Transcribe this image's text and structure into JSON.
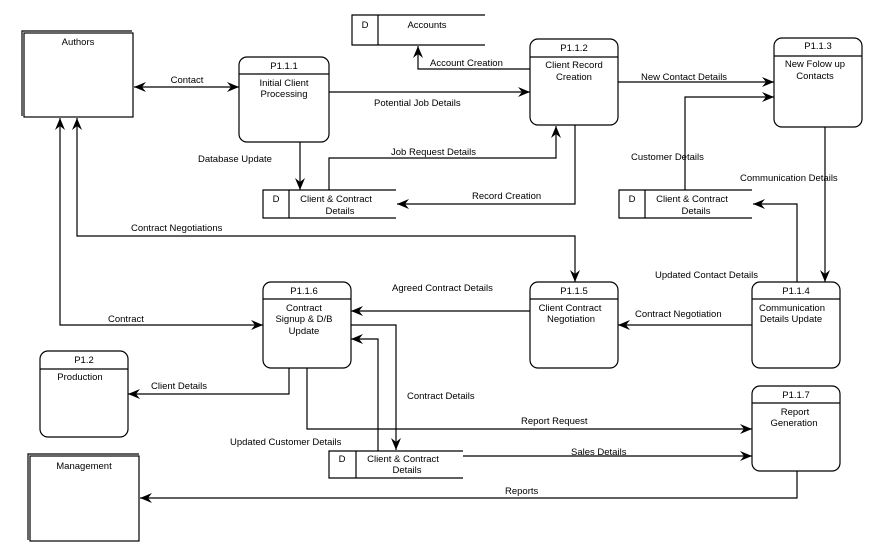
{
  "entities": {
    "authors": "Authors",
    "management": "Management"
  },
  "processes": {
    "p111": {
      "id": "P1.1.1",
      "lines": [
        "Initial Client",
        "Processing"
      ]
    },
    "p112": {
      "id": "P1.1.2",
      "lines": [
        "Client Record",
        "Creation"
      ]
    },
    "p113": {
      "id": "P1.1.3",
      "lines": [
        "New Folow up",
        "Contacts"
      ]
    },
    "p114": {
      "id": "P1.1.4",
      "lines": [
        "Communication",
        "Details Update"
      ]
    },
    "p115": {
      "id": "P1.1.5",
      "lines": [
        "Client Contract",
        "Negotiation"
      ]
    },
    "p116": {
      "id": "P1.1.6",
      "lines": [
        "Contract",
        "Signup & D/B",
        "Update"
      ]
    },
    "p117": {
      "id": "P1.1.7",
      "lines": [
        "Report",
        "Generation"
      ]
    },
    "p12": {
      "id": "P1.2",
      "lines": [
        "Production"
      ]
    }
  },
  "stores": {
    "accounts": {
      "tag": "D",
      "lines": [
        "Accounts"
      ]
    },
    "ccd1": {
      "tag": "D",
      "lines": [
        "Client & Contract",
        "Details"
      ]
    },
    "ccd2": {
      "tag": "D",
      "lines": [
        "Client & Contract",
        "Details"
      ]
    },
    "ccd3": {
      "tag": "D",
      "lines": [
        "Client & Contract",
        "Details"
      ]
    }
  },
  "flows": {
    "contact": "Contact",
    "potential_job": "Potential Job Details",
    "account_creation": "Account Creation",
    "database_update": "Database Update",
    "job_request": "Job Request Details",
    "record_creation": "Record Creation",
    "new_contact": "New Contact Details",
    "customer_details": "Customer Details",
    "communication_details": "Communication Details",
    "updated_contact": "Updated Contact Details",
    "contract_negotiations": "Contract Negotiations",
    "contract": "Contract",
    "contract_negotiation": "Contract Negotiation",
    "agreed_contract": "Agreed Contract Details",
    "contract_details": "Contract Details",
    "updated_customer": "Updated Customer Details",
    "client_details": "Client Details",
    "report_request": "Report Request",
    "sales_details": "Sales Details",
    "reports": "Reports"
  }
}
